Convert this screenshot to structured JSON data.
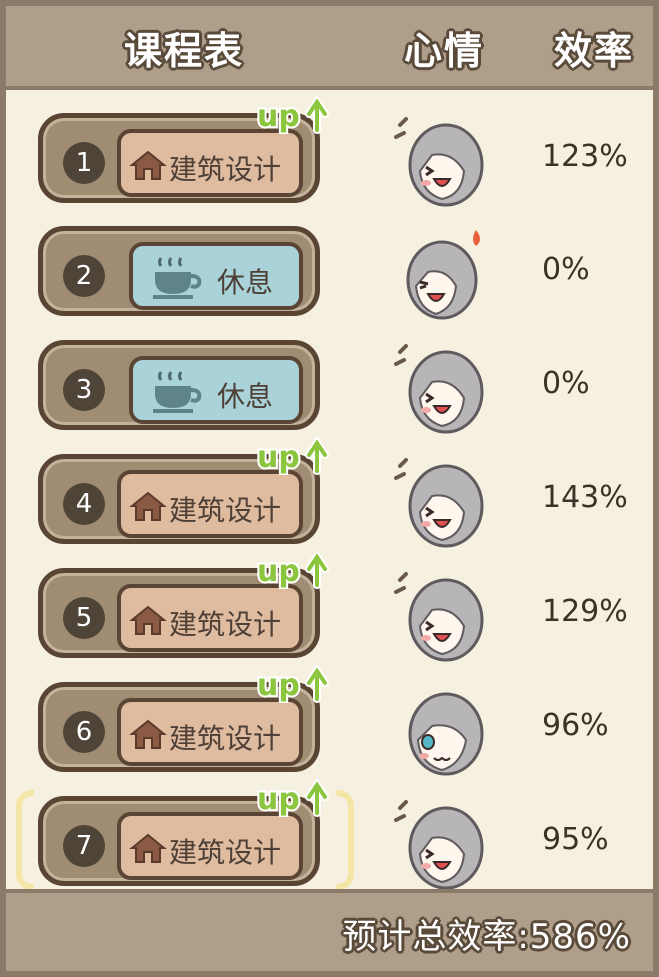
{
  "header": {
    "schedule": "课程表",
    "mood": "心情",
    "efficiency": "效率"
  },
  "rows": [
    {
      "number": "1",
      "type": "class",
      "icon": "house-icon",
      "label": "建筑设计",
      "badge": "up",
      "mood": "happy",
      "efficiency": "123%"
    },
    {
      "number": "2",
      "type": "rest",
      "icon": "cup-icon",
      "label": "休息",
      "badge": "",
      "mood": "angry",
      "efficiency": "0%"
    },
    {
      "number": "3",
      "type": "rest",
      "icon": "cup-icon",
      "label": "休息",
      "badge": "",
      "mood": "happy",
      "efficiency": "0%"
    },
    {
      "number": "4",
      "type": "class",
      "icon": "house-icon",
      "label": "建筑设计",
      "badge": "up",
      "mood": "happy",
      "efficiency": "143%"
    },
    {
      "number": "5",
      "type": "class",
      "icon": "house-icon",
      "label": "建筑设计",
      "badge": "up",
      "mood": "happy",
      "efficiency": "129%"
    },
    {
      "number": "6",
      "type": "class",
      "icon": "house-icon",
      "label": "建筑设计",
      "badge": "up",
      "mood": "neutral",
      "efficiency": "96%"
    },
    {
      "number": "7",
      "type": "class",
      "icon": "house-icon",
      "label": "建筑设计",
      "badge": "up",
      "mood": "happy",
      "efficiency": "95%"
    }
  ],
  "selected_row": 7,
  "footer": {
    "total": "预计总效率:586%"
  },
  "colors": {
    "background": "#f5f0df",
    "header": "#ae9e8a",
    "slot": "#a08c73",
    "class_card": "#dfbba0",
    "rest_card": "#a9d3d8",
    "up_green": "#8cc63f",
    "selection": "#f3e6a6",
    "hair": "#b7b5b8"
  }
}
